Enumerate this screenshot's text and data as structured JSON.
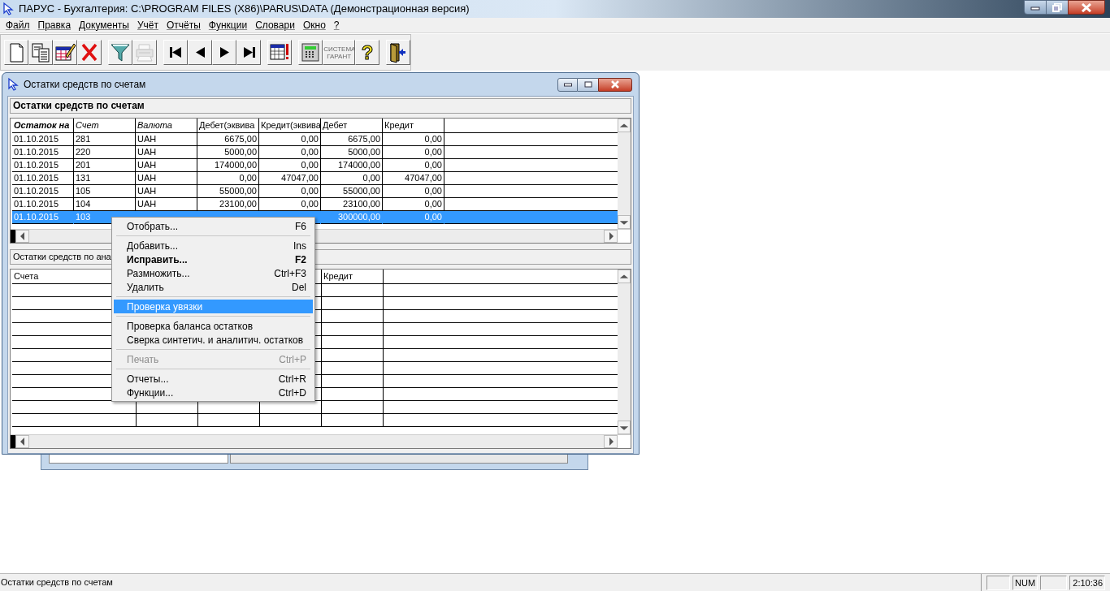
{
  "app": {
    "title": "ПАРУС - Бухгалтерия: C:\\PROGRAM FILES (X86)\\PARUS\\DATA (Демонстрационная версия)"
  },
  "menu_bar": [
    "Файл",
    "Правка",
    "Документы",
    "Учёт",
    "Отчёты",
    "Функции",
    "Словари",
    "Окно",
    "?"
  ],
  "toolbar": [
    {
      "kind": "new",
      "disabled": false
    },
    {
      "kind": "copy",
      "disabled": false
    },
    {
      "kind": "edit",
      "disabled": false
    },
    {
      "kind": "delete",
      "disabled": false
    },
    {
      "kind": "gap"
    },
    {
      "kind": "filter",
      "disabled": false
    },
    {
      "kind": "print",
      "disabled": true
    },
    {
      "kind": "gap"
    },
    {
      "kind": "first",
      "disabled": false
    },
    {
      "kind": "prev",
      "disabled": false
    },
    {
      "kind": "next",
      "disabled": false
    },
    {
      "kind": "last",
      "disabled": false
    },
    {
      "kind": "gap"
    },
    {
      "kind": "alert",
      "disabled": false
    },
    {
      "kind": "gap"
    },
    {
      "kind": "calc",
      "disabled": false
    },
    {
      "kind": "logo",
      "disabled": true,
      "label": "СИСТЕМА ГАРАНТ"
    },
    {
      "kind": "help",
      "disabled": false,
      "label": "?"
    },
    {
      "kind": "gap"
    },
    {
      "kind": "exit",
      "disabled": false
    }
  ],
  "window": {
    "title": "Остатки средств по счетам",
    "header": "Остатки средств по счетам",
    "columns": [
      {
        "label": "Остаток на",
        "kind": "sorted"
      },
      {
        "label": "Счет",
        "kind": "italic"
      },
      {
        "label": "Валюта",
        "kind": "italic"
      },
      {
        "label": "Дебет(эквива",
        "kind": "numeric"
      },
      {
        "label": "Кредит(эквива",
        "kind": "numeric"
      },
      {
        "label": "Дебет",
        "kind": "numeric"
      },
      {
        "label": "Кредит",
        "kind": "numeric"
      }
    ],
    "rows": [
      {
        "selected": false,
        "cells": [
          "01.10.2015",
          "281",
          "UAH",
          "6675,00",
          "0,00",
          "6675,00",
          "0,00"
        ]
      },
      {
        "selected": false,
        "cells": [
          "01.10.2015",
          "220",
          "UAH",
          "5000,00",
          "0,00",
          "5000,00",
          "0,00"
        ]
      },
      {
        "selected": false,
        "cells": [
          "01.10.2015",
          "201",
          "UAH",
          "174000,00",
          "0,00",
          "174000,00",
          "0,00"
        ]
      },
      {
        "selected": false,
        "cells": [
          "01.10.2015",
          "131",
          "UAH",
          "0,00",
          "47047,00",
          "0,00",
          "47047,00"
        ]
      },
      {
        "selected": false,
        "cells": [
          "01.10.2015",
          "105",
          "UAH",
          "55000,00",
          "0,00",
          "55000,00",
          "0,00"
        ]
      },
      {
        "selected": false,
        "cells": [
          "01.10.2015",
          "104",
          "UAH",
          "23100,00",
          "0,00",
          "23100,00",
          "0,00"
        ]
      },
      {
        "selected": true,
        "cells": [
          "01.10.2015",
          "103",
          null,
          null,
          null,
          "300000,00",
          "0,00"
        ]
      }
    ],
    "detail_header": "Остатки средств по ана",
    "detail_columns": [
      {
        "label": "Счета"
      },
      {},
      {},
      {},
      {
        "label": "Кредит"
      }
    ]
  },
  "context_menu": [
    {
      "kind": "item",
      "label": "Отобрать...",
      "shortcut": "F6",
      "bold": false,
      "disabled": false,
      "selected": false
    },
    {
      "kind": "separator"
    },
    {
      "kind": "item",
      "label": "Добавить...",
      "shortcut": "Ins",
      "bold": false,
      "disabled": false,
      "selected": false
    },
    {
      "kind": "item",
      "label": "Исправить...",
      "shortcut": "F2",
      "bold": true,
      "disabled": false,
      "selected": false
    },
    {
      "kind": "item",
      "label": "Размножить...",
      "shortcut": "Ctrl+F3",
      "bold": false,
      "disabled": false,
      "selected": false
    },
    {
      "kind": "item",
      "label": "Удалить",
      "shortcut": "Del",
      "bold": false,
      "disabled": false,
      "selected": false
    },
    {
      "kind": "separator"
    },
    {
      "kind": "item",
      "label": "Проверка увязки",
      "bold": false,
      "disabled": false,
      "selected": true
    },
    {
      "kind": "separator"
    },
    {
      "kind": "item",
      "label": "Проверка баланса остатков",
      "bold": false,
      "disabled": false,
      "selected": false
    },
    {
      "kind": "item",
      "label": "Сверка синтетич. и аналитич. остатков",
      "bold": false,
      "disabled": false,
      "selected": false
    },
    {
      "kind": "separator"
    },
    {
      "kind": "item",
      "label": "Печать",
      "shortcut": "Ctrl+P",
      "bold": false,
      "disabled": true,
      "selected": false
    },
    {
      "kind": "separator"
    },
    {
      "kind": "item",
      "label": "Отчеты...",
      "shortcut": "Ctrl+R",
      "bold": false,
      "disabled": false,
      "selected": false
    },
    {
      "kind": "item",
      "label": "Функции...",
      "shortcut": "Ctrl+D",
      "bold": false,
      "disabled": false,
      "selected": false
    }
  ],
  "status_bar": {
    "text": "Остатки средств по счетам",
    "panels": [
      {
        "kind": "blank"
      },
      {
        "kind": "text",
        "text": "NUM"
      },
      {
        "kind": "blank"
      },
      {
        "kind": "text",
        "text": "2:10:36"
      }
    ]
  }
}
